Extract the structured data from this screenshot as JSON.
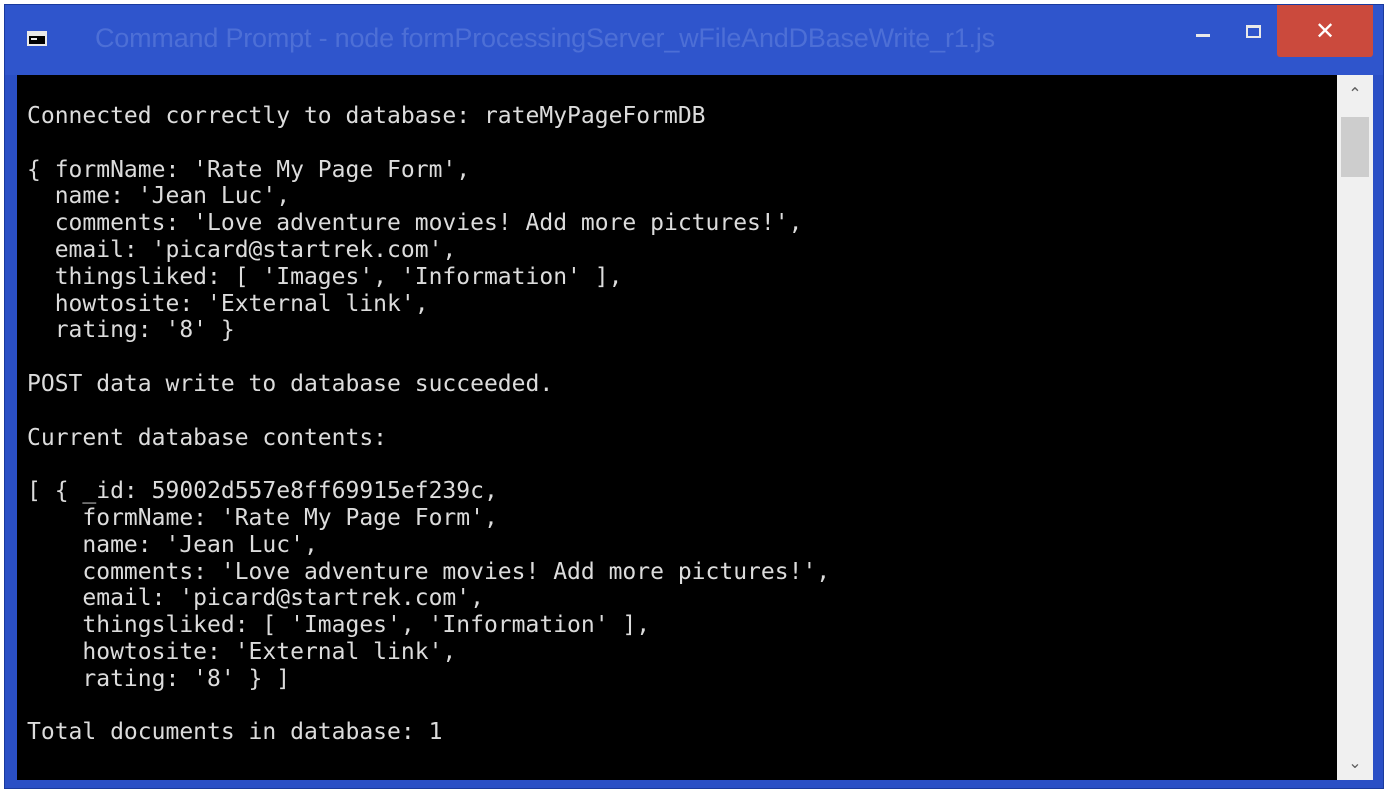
{
  "window": {
    "title": "Command Prompt - node  formProcessingServer_wFileAndDBaseWrite_r1.js",
    "app_icon": "console-icon",
    "close_glyph": "✕"
  },
  "console": {
    "lines": [
      "Connected correctly to database: rateMyPageFormDB",
      "",
      "{ formName: 'Rate My Page Form',",
      "  name: 'Jean Luc',",
      "  comments: 'Love adventure movies! Add more pictures!',",
      "  email: 'picard@startrek.com',",
      "  thingsliked: [ 'Images', 'Information' ],",
      "  howtosite: 'External link',",
      "  rating: '8' }",
      "",
      "POST data write to database succeeded.",
      "",
      "Current database contents:",
      "",
      "[ { _id: 59002d557e8ff69915ef239c,",
      "    formName: 'Rate My Page Form',",
      "    name: 'Jean Luc',",
      "    comments: 'Love adventure movies! Add more pictures!',",
      "    email: 'picard@startrek.com',",
      "    thingsliked: [ 'Images', 'Information' ],",
      "    howtosite: 'External link',",
      "    rating: '8' } ]",
      "",
      "Total documents in database: 1"
    ]
  },
  "scrollbar": {
    "up_glyph": "⌃",
    "down_glyph": "⌄"
  },
  "colors": {
    "titlebar": "#2f55cc",
    "title_text": "#4d6fd6",
    "close_button": "#cb4a3d",
    "console_bg": "#000000",
    "console_text": "#dcdcdc"
  }
}
